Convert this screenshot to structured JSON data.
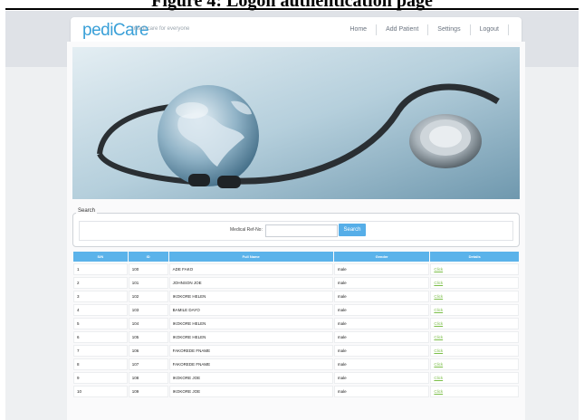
{
  "figure_caption": "Figure 4: Logon authentication page",
  "app": {
    "logo": "pediCare",
    "tagline": "Infant care for everyone"
  },
  "nav": [
    {
      "label": "Home"
    },
    {
      "label": "Add Patient"
    },
    {
      "label": "Settings"
    },
    {
      "label": "Logout"
    }
  ],
  "search": {
    "legend": "Search",
    "label": "Medical Ref-No:",
    "value": "",
    "button": "Search"
  },
  "table": {
    "headers": [
      "S/N",
      "ID",
      "Full Name",
      "Gender",
      "Details"
    ],
    "rows": [
      {
        "sn": "1",
        "id": "100",
        "name": "ADE FAKO",
        "gender": "male",
        "details": "Click"
      },
      {
        "sn": "2",
        "id": "101",
        "name": "JOHNSON JOE",
        "gender": "male",
        "details": "Click"
      },
      {
        "sn": "3",
        "id": "102",
        "name": "IKOKORE HELEN",
        "gender": "male",
        "details": "Click"
      },
      {
        "sn": "4",
        "id": "103",
        "name": "BAMILE DAYO",
        "gender": "male",
        "details": "Click"
      },
      {
        "sn": "5",
        "id": "104",
        "name": "IKOKORE HELEN",
        "gender": "male",
        "details": "Click"
      },
      {
        "sn": "6",
        "id": "105",
        "name": "IKOKORE HELEN",
        "gender": "male",
        "details": "Click"
      },
      {
        "sn": "7",
        "id": "106",
        "name": "FAKOREDE FNAME",
        "gender": "male",
        "details": "Click"
      },
      {
        "sn": "8",
        "id": "107",
        "name": "FAKOREDE FNAME",
        "gender": "male",
        "details": "Click"
      },
      {
        "sn": "9",
        "id": "108",
        "name": "IKOKORE JOE",
        "gender": "male",
        "details": "Click"
      },
      {
        "sn": "10",
        "id": "109",
        "name": "IKOKORE JOE",
        "gender": "male",
        "details": "Click"
      }
    ]
  },
  "colors": {
    "brand": "#3aa0d8",
    "table_header": "#5bb3ea",
    "link": "#7cbf4a"
  }
}
